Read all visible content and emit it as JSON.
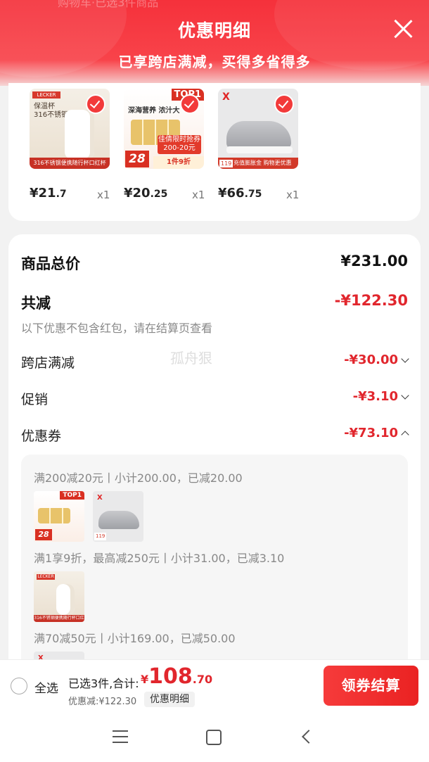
{
  "header": {
    "ghost_text": "购物车·已选3件商品",
    "title": "优惠明细",
    "subtitle": "已享跨店满减，买得多省得多"
  },
  "products": [
    {
      "price_main": "¥21",
      "price_dec": ".7",
      "qty": "x1",
      "brand": "LECKER",
      "text": "保温杯\n316不锈钢内胆",
      "band": "316不锈钢便携随行杯口红杯"
    },
    {
      "price_main": "¥20",
      "price_dec": ".25",
      "qty": "x1",
      "badge": "TOP1",
      "headline": "深海营养 浓汁大",
      "promo": "佳倩限时抢券\n200-20元",
      "number": "28",
      "deal": "1件9折"
    },
    {
      "price_main": "¥66",
      "price_dec": ".75",
      "qty": "x1",
      "logo": "X",
      "price_tag": "119",
      "strip": "充值膨胀金 购物更优惠"
    }
  ],
  "summary": {
    "total_label": "商品总价",
    "total_value": "¥231.00",
    "discount_label": "共减",
    "discount_value": "-¥122.30",
    "note": "以下优惠不包含红包，请在结算页查看",
    "watermark": "孤舟狠",
    "items": [
      {
        "label": "跨店满减",
        "value": "-¥30.00"
      },
      {
        "label": "促销",
        "value": "-¥3.10"
      },
      {
        "label": "优惠券",
        "value": "-¥73.10"
      }
    ]
  },
  "coupons": [
    "满200减20元丨小计200.00，已减20.00",
    "满1享9折，最高减250元丨小计31.00，已减3.10",
    "满70减50元丨小计169.00，已减50.00"
  ],
  "bottom": {
    "select_all": "全选",
    "selected": "已选3件,合计:",
    "total_yen": "¥",
    "total_int": "108",
    "total_dec": ".70",
    "savings": "优惠减:¥122.30",
    "detail_button": "优惠明细",
    "checkout": "领券结算"
  },
  "colors": {
    "accent": "#e1262d",
    "header": "#f5313b"
  }
}
